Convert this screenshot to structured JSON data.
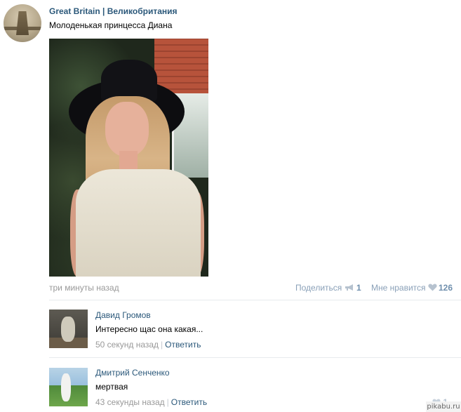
{
  "post": {
    "group_name": "Great Britain | Великобритания",
    "text": "Молоденькая принцесса Диана",
    "time": "три минуты назад",
    "share_label": "Поделиться",
    "share_count": "1",
    "like_label": "Мне нравится",
    "like_count": "126"
  },
  "comments": [
    {
      "author": "Давид Громов",
      "text": "Интересно щас она какая...",
      "time": "50 секунд назад",
      "separator": "|",
      "reply_label": "Ответить"
    },
    {
      "author": "Дмитрий Сенченко",
      "text": "мертвая",
      "time": "43 секунды назад",
      "separator": "|",
      "reply_label": "Ответить",
      "like_count": "1"
    }
  ],
  "watermark": "pikabu.ru",
  "colors": {
    "link": "#2b587a",
    "muted": "#999999",
    "action": "#8aa0b8",
    "divider": "#e7eaed"
  },
  "icons": {
    "share": "megaphone-icon",
    "like": "heart-icon"
  }
}
